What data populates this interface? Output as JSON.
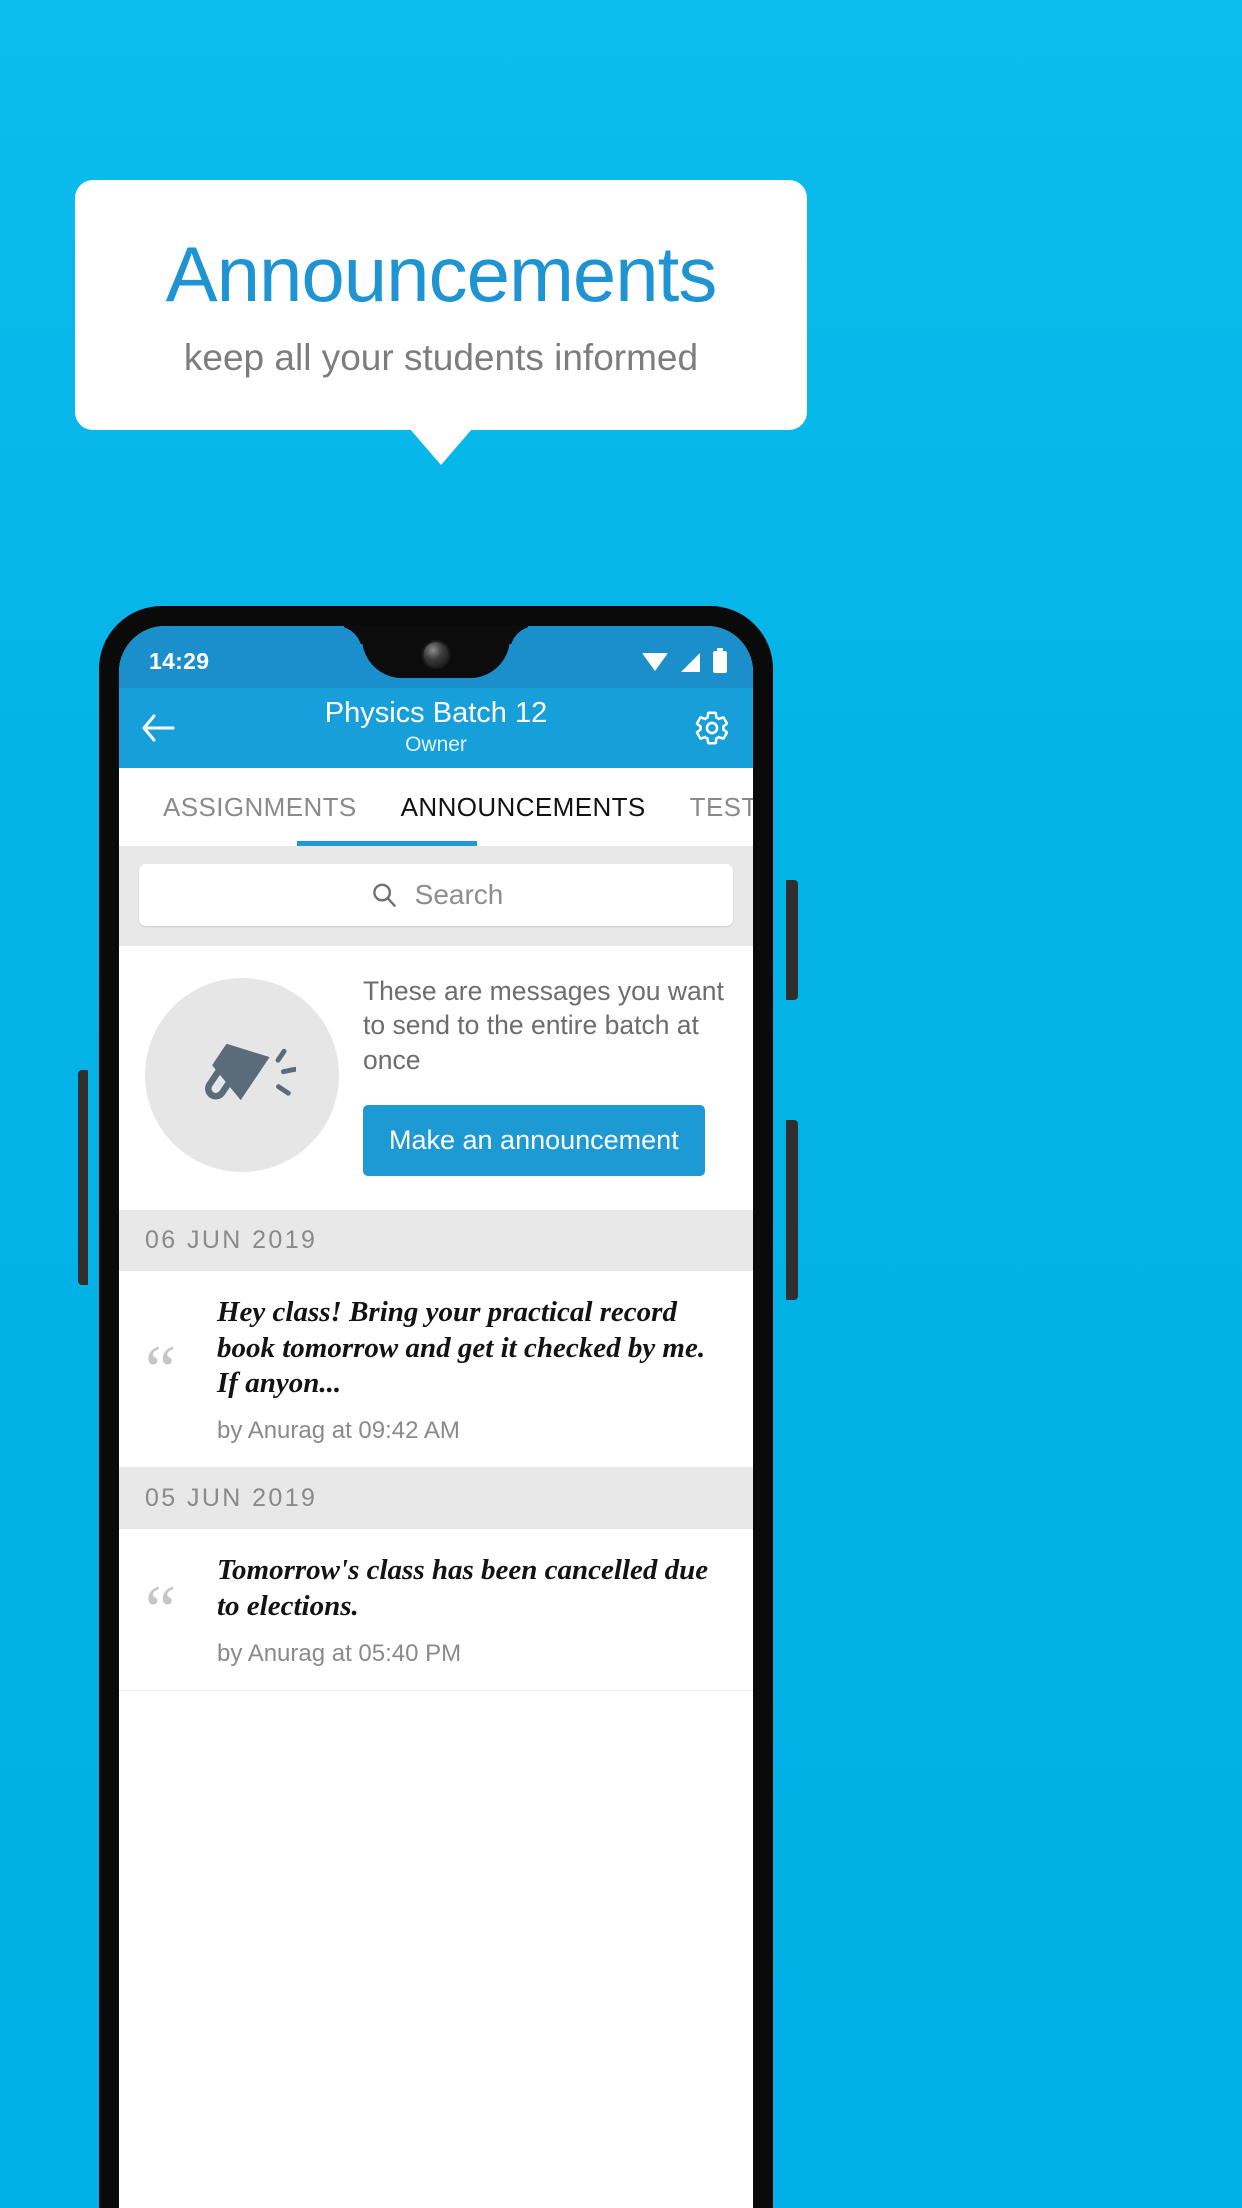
{
  "promo": {
    "title": "Announcements",
    "subtitle": "keep all your students informed"
  },
  "phone": {
    "status": {
      "time": "14:29",
      "icons": [
        "wifi-icon",
        "signal-icon",
        "battery-icon"
      ]
    },
    "appbar": {
      "back_icon": "back-arrow-icon",
      "title": "Physics Batch 12",
      "subtitle": "Owner",
      "settings_icon": "gear-icon"
    },
    "tabs": [
      {
        "label": "ASSIGNMENTS",
        "active": false
      },
      {
        "label": "ANNOUNCEMENTS",
        "active": true
      },
      {
        "label": "TESTS",
        "active": false
      },
      {
        "label": "’",
        "active": false
      }
    ],
    "search": {
      "icon": "search-icon",
      "placeholder": "Search",
      "value": ""
    },
    "empty_state": {
      "icon": "megaphone-icon",
      "text": "These are messages you want to send to the entire batch at once",
      "button_label": "Make an announcement"
    },
    "announcements": [
      {
        "date": "06  JUN  2019",
        "text": "Hey class! Bring your practical record book tomorrow and get it checked by me. If anyon...",
        "meta": "by Anurag at 09:42 AM"
      },
      {
        "date": "05  JUN  2019",
        "text": "Tomorrow's class has been cancelled due to elections.",
        "meta": "by Anurag at 05:40 PM"
      }
    ]
  },
  "colors": {
    "background": "#00b0e6",
    "accent": "#1d9ad4",
    "title_blue": "#1e94d2",
    "appbar": "#169fd9",
    "statusbar": "#1a8fcb"
  }
}
